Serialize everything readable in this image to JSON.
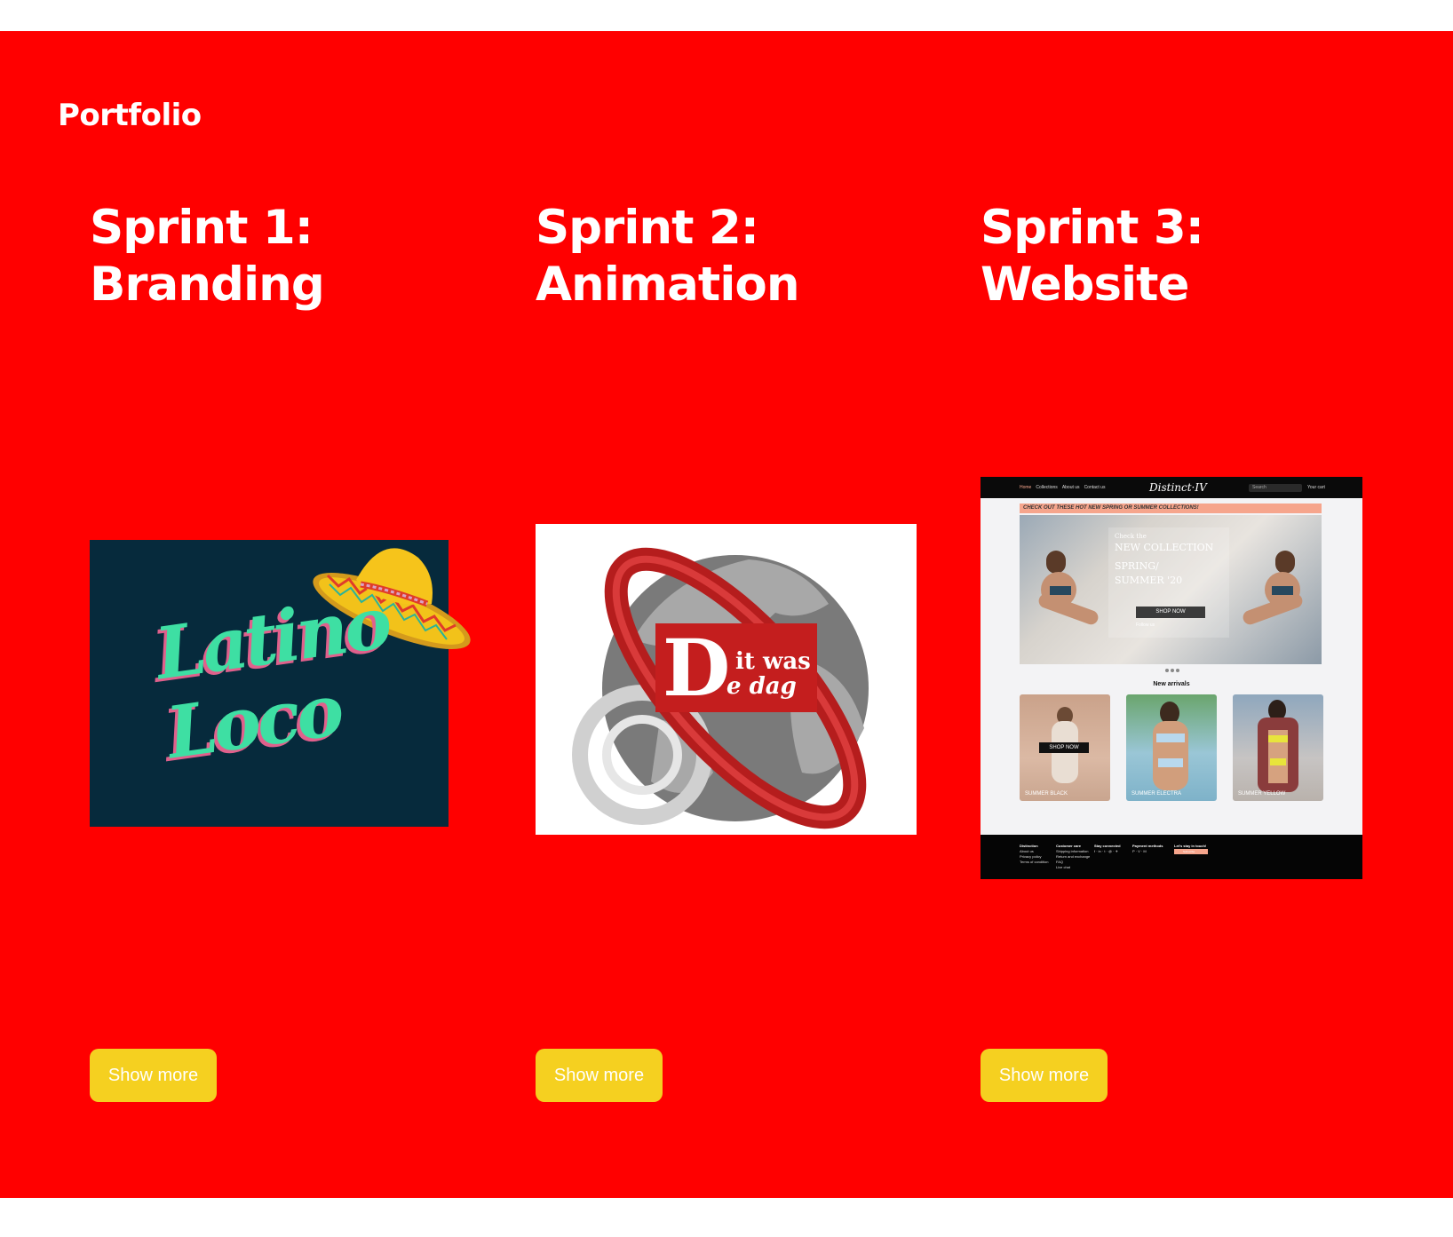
{
  "section": {
    "title": "Portfolio",
    "background": "#ff0000",
    "button_color": "#f5d020"
  },
  "projects": [
    {
      "title_line1": "Sprint 1:",
      "title_line2": "Branding",
      "button": "Show more",
      "image": {
        "text_line1": "Latino",
        "text_line2": "Loco"
      }
    },
    {
      "title_line1": "Sprint 2:",
      "title_line2": "Animation",
      "button": "Show more",
      "image": {
        "big_letter": "D",
        "text_line1": "it was",
        "text_line2": "e dag"
      }
    },
    {
      "title_line1": "Sprint 3:",
      "title_line2": "Website",
      "button": "Show more",
      "image": {
        "nav_links": [
          "Home",
          "Collections",
          "About us",
          "Contact us"
        ],
        "brand": "Distinct·IV",
        "search_placeholder": "Search",
        "cart": "Your cart",
        "banner": "CHECK OUT THESE HOT NEW SPRING OR SUMMER COLLECTIONS!",
        "hero_line1": "Check the",
        "hero_line2": "NEW COLLECTION",
        "hero_line3": "SPRING/ SUMMER '20",
        "hero_button": "SHOP NOW",
        "follow": "Follow us",
        "section_title": "New arrivals",
        "cards": [
          "SUMMER BLACK",
          "SUMMER ELECTRA",
          "SUMMER YELLOW"
        ],
        "card_button": "SHOP NOW",
        "footer": [
          {
            "head": "Distinction",
            "lines": [
              "About us",
              "Privacy policy",
              "Terms of condition"
            ]
          },
          {
            "head": "Customer care",
            "lines": [
              "Shipping information",
              "Return and exchange",
              "FAQ",
              "Live chat"
            ]
          },
          {
            "head": "Stay connected",
            "lines": [
              "f · in · t · @ · ✈"
            ]
          },
          {
            "head": "Payment methods",
            "lines": [
              "P · V · M"
            ]
          },
          {
            "head": "Let's stay in touch!",
            "lines": [
              "Subscribe"
            ]
          }
        ]
      }
    }
  ]
}
